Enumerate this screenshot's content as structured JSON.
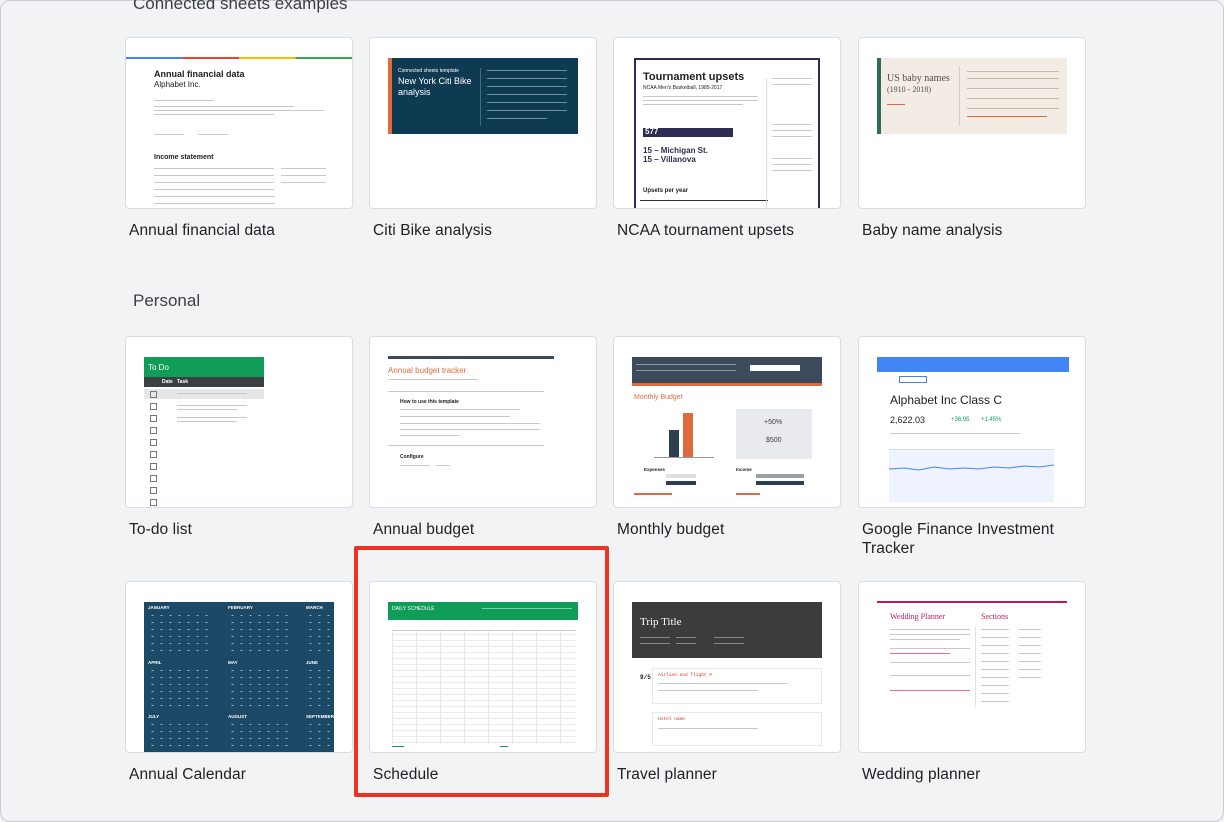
{
  "sections": [
    {
      "title": "Connected sheets examples"
    },
    {
      "title": "Personal"
    }
  ],
  "cards": [
    {
      "label": "Annual financial data",
      "thumb_title": "Annual financial data",
      "thumb_subtitle": "Alphabet Inc.",
      "thumb_section": "Income statement"
    },
    {
      "label": "Citi Bike analysis",
      "thumb_kicker": "Connected sheets template",
      "thumb_title": "New York Citi Bike analysis"
    },
    {
      "label": "NCAA tournament upsets",
      "thumb_title": "Tournament upsets",
      "thumb_subtitle": "NCAA Men's Basketball, 1985-2017",
      "thumb_number": "577",
      "thumb_line1": "15 – Michigan St.",
      "thumb_line2": "15 – Villanova",
      "thumb_section": "Upsets per year"
    },
    {
      "label": "Baby name analysis",
      "thumb_title": "US baby names",
      "thumb_subtitle": "(1910 - 2018)"
    },
    {
      "label": "To-do list",
      "thumb_title": "To Do",
      "thumb_col1": "Date",
      "thumb_col2": "Task"
    },
    {
      "label": "Annual budget",
      "thumb_title": "Annual budget tracker",
      "thumb_section1": "How to use this template",
      "thumb_section2": "Configure"
    },
    {
      "label": "Monthly budget",
      "thumb_title": "Monthly Budget",
      "thumb_stat1": "+50%",
      "thumb_stat2": "$500",
      "thumb_expenses": "Expenses",
      "thumb_income": "Income"
    },
    {
      "label": "Google Finance Investment Tracker",
      "thumb_title": "Alphabet Inc Class C",
      "thumb_price": "2,622.03",
      "thumb_change": "+36.95",
      "thumb_change_pct": "+1.45%"
    },
    {
      "label": "Annual Calendar",
      "thumb_months": [
        "JANUARY",
        "FEBRUARY",
        "MARCH",
        "APRIL",
        "MAY",
        "JUNE",
        "JULY",
        "AUGUST",
        "SEPTEMBER"
      ]
    },
    {
      "label": "Schedule",
      "thumb_title": "DAILY SCHEDULE"
    },
    {
      "label": "Travel planner",
      "thumb_title": "Trip Title",
      "thumb_date": "9/5",
      "thumb_flight": "Airline and flight #",
      "thumb_hotel": "Hotel name"
    },
    {
      "label": "Wedding planner",
      "thumb_title": "Wedding Planner",
      "thumb_sections": "Sections"
    }
  ],
  "colors": {
    "accent_red": "#ea3323",
    "sheets_green": "#0f9d58",
    "calendar_navy": "#1c4966",
    "citibike_navy": "#0e3a52"
  }
}
